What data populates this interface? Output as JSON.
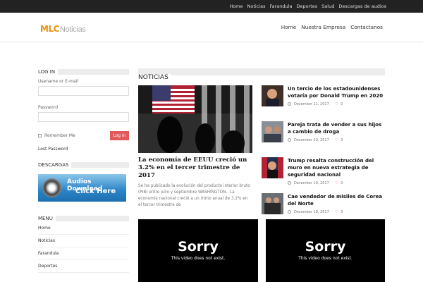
{
  "topbar": {
    "items": [
      "Home",
      "Noticias",
      "Farandula",
      "Deportes",
      "Salud",
      "Descargas de audios"
    ]
  },
  "header": {
    "logo": {
      "brand": "MLC",
      "suffix": "Noticias"
    },
    "nav": [
      "Home",
      "Nuestra Empresa",
      "Contactanos"
    ]
  },
  "sidebar": {
    "login_title": "LOG IN",
    "username_label": "Usename or E-mail",
    "password_label": "Password",
    "remember_label": "Remember Me",
    "login_button": "Log In",
    "lost_password": "Lost Password",
    "downloads_title": "DESCARGAS",
    "banner_line1": "Audios Download",
    "banner_line2": "Click Here",
    "menu_title": "MENU",
    "menu_items": [
      "Home",
      "Noticias",
      "Farandula",
      "Deportes"
    ]
  },
  "news": {
    "section_title": "NOTICIAS",
    "feature": {
      "title": "La economía de EEUU creció un 3.2% en el tercer trimestre de 2017",
      "excerpt": "Se ha publicado la evolución del producto interior bruto (PIB) entre julio y septiembre WASHINGTON.- La economía nacional creció a un ritmo anual de 3.2% en el tercer trimestre de"
    },
    "items": [
      {
        "title": "Un tercio de los estadounidenses votaría por Donald Trump en 2020",
        "date": "December 21, 2017",
        "likes": "0"
      },
      {
        "title": "Pareja trata de vender a sus hijos a cambio de droga",
        "date": "December 20, 2017",
        "likes": "0"
      },
      {
        "title": "Trump resalta construcción del muro en nueva estrategia de seguridad nacional",
        "date": "December 19, 2017",
        "likes": "0"
      },
      {
        "title": "Cae vendedor de misiles de Corea del Norte",
        "date": "December 18, 2017",
        "likes": "0"
      }
    ]
  },
  "videos": [
    {
      "headline": "Sorry",
      "message": "This video does not exist."
    },
    {
      "headline": "Sorry",
      "message": "This video does not exist."
    }
  ],
  "colors": {
    "topbar": "#222222",
    "accent": "#e05a5a",
    "logo_orange": "#e8920f"
  }
}
